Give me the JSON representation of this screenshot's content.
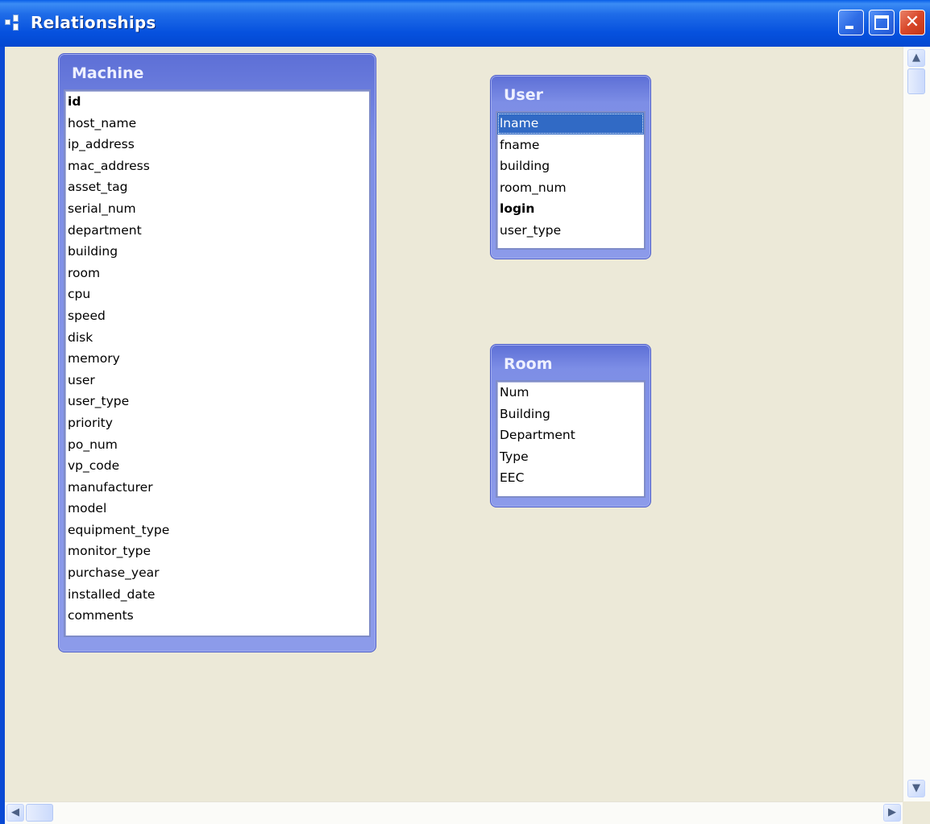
{
  "window": {
    "title": "Relationships",
    "colors": {
      "titlebar": "#0651de",
      "client": "#ece9d8",
      "table_header": "#7d8ee6",
      "selection": "#316ac5",
      "close": "#d9482a"
    }
  },
  "icons": {
    "app": "relationships-icon",
    "minimize": "minimize-icon",
    "maximize": "maximize-icon",
    "close": "close-icon",
    "scroll_up": "arrow-up-icon",
    "scroll_down": "arrow-down-icon",
    "scroll_left": "arrow-left-icon",
    "scroll_right": "arrow-right-icon"
  },
  "scroll_glyphs": {
    "up": "▲",
    "down": "▼",
    "left": "◀",
    "right": "▶",
    "close": "✕"
  },
  "tables": {
    "machine": {
      "name": "Machine",
      "fields": [
        "id",
        "host_name",
        "ip_address",
        "mac_address",
        "asset_tag",
        "serial_num",
        "department",
        "building",
        "room",
        "cpu",
        "speed",
        "disk",
        "memory",
        "user",
        "user_type",
        "priority",
        "po_num",
        "vp_code",
        "manufacturer",
        "model",
        "equipment_type",
        "monitor_type",
        "purchase_year",
        "installed_date",
        "comments"
      ],
      "primary_key": "id"
    },
    "user": {
      "name": "User",
      "fields": [
        "lname",
        "fname",
        "building",
        "room_num",
        "login",
        "user_type"
      ],
      "primary_key": "login",
      "selected_field": "lname"
    },
    "room": {
      "name": "Room",
      "fields": [
        "Num",
        "Building",
        "Department",
        "Type",
        "EEC"
      ]
    }
  }
}
